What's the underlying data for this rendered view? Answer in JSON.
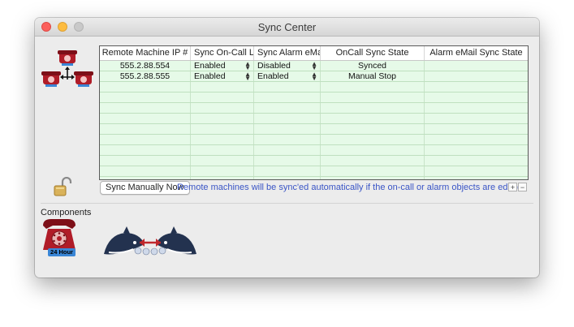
{
  "window": {
    "title": "Sync Center"
  },
  "table": {
    "columns": [
      "Remote Machine IP #",
      "Sync On-Call List",
      "Sync Alarm eMail",
      "OnCall Sync State",
      "Alarm eMail Sync State"
    ],
    "rows": [
      {
        "ip": "555.2.88.554",
        "sync_oncall": "Enabled",
        "sync_alarm": "Disabled",
        "oncall_state": "Synced",
        "alarm_state": ""
      },
      {
        "ip": "555.2.88.555",
        "sync_oncall": "Enabled",
        "sync_alarm": "Enabled",
        "oncall_state": "Manual Stop",
        "alarm_state": ""
      }
    ],
    "empty_row_count": 10
  },
  "buttons": {
    "sync_manually": "Sync Manually Now",
    "add": "+",
    "remove": "−"
  },
  "notice": "Remote machines will be sync'ed automatically if the on-call or alarm objects are edited",
  "components": {
    "label": "Components",
    "badge": "24 Hour"
  },
  "icons": {
    "phone_group": "red-phones-network-icon",
    "lock": "unlocked-padlock-icon",
    "phone_24": "red-phone-24-hour-icon",
    "whales": "whale-sync-icon"
  },
  "colors": {
    "table_bg": "#e6fae8",
    "notice_text": "#3a55c6",
    "phone_red": "#b01c28",
    "badge_blue": "#3a86d6"
  }
}
